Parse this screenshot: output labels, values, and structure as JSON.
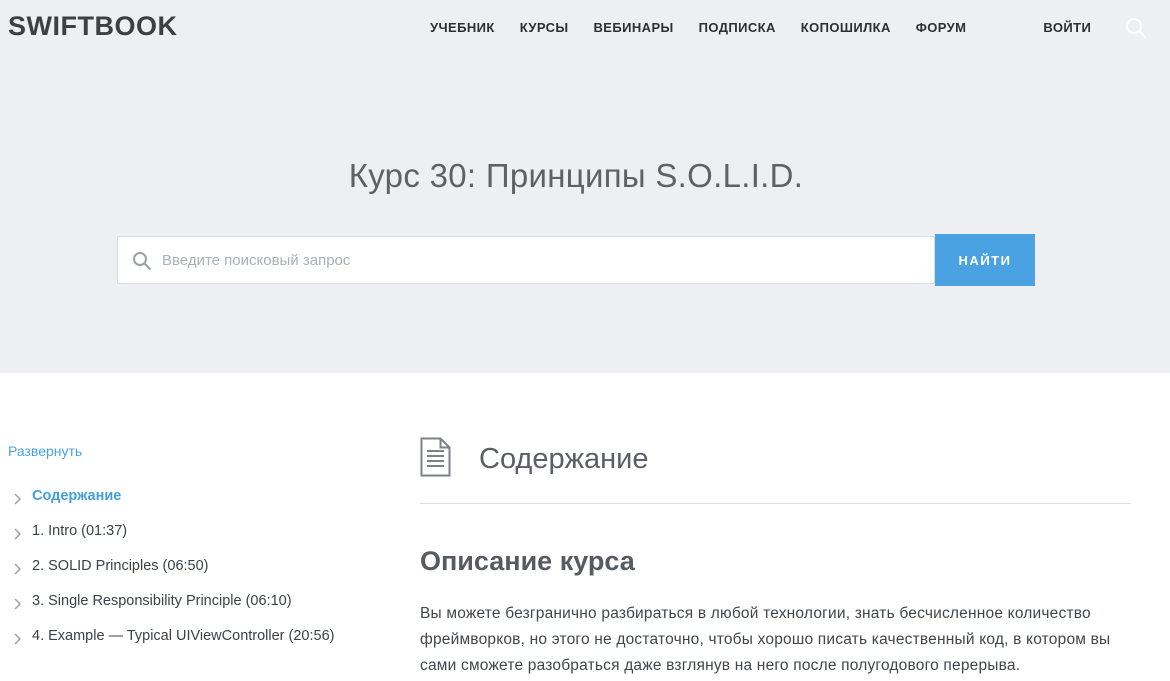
{
  "header": {
    "logo": "SWIFTBOOK",
    "nav_items": [
      {
        "label": "УЧЕБНИК"
      },
      {
        "label": "КУРСЫ"
      },
      {
        "label": "ВЕБИНАРЫ"
      },
      {
        "label": "ПОДПИСКА"
      },
      {
        "label": "КОПОШИЛКА"
      },
      {
        "label": "ФОРУМ"
      }
    ],
    "login_label": "ВОЙТИ"
  },
  "hero": {
    "title": "Курс 30: Принципы S.O.L.I.D.",
    "search_placeholder": "Введите поисковый запрос",
    "search_button_label": "НАЙТИ"
  },
  "sidebar": {
    "expand_label": "Развернуть",
    "items": [
      {
        "label": "Содержание",
        "active": true
      },
      {
        "label": "1. Intro (01:37)",
        "active": false
      },
      {
        "label": "2. SOLID Principles (06:50)",
        "active": false
      },
      {
        "label": "3. Single Responsibility Principle (06:10)",
        "active": false
      },
      {
        "label": "4. Example — Typical UIViewController (20:56)",
        "active": false
      }
    ]
  },
  "main": {
    "section_title": "Содержание",
    "subsection_title": "Описание курса",
    "description": "Вы можете безгранично разбираться в любой технологии, знать бесчисленное количество фреймворков, но этого не достаточно, чтобы хорошо писать качественный код, в котором вы сами сможете разобраться даже взглянув на него после полугодового перерыва."
  },
  "colors": {
    "hero_background": "#edeff3",
    "accent_blue": "#4aa2e2",
    "link_blue": "#4aa3df",
    "heading_gray": "#5a5f65",
    "body_text": "#41464c"
  }
}
